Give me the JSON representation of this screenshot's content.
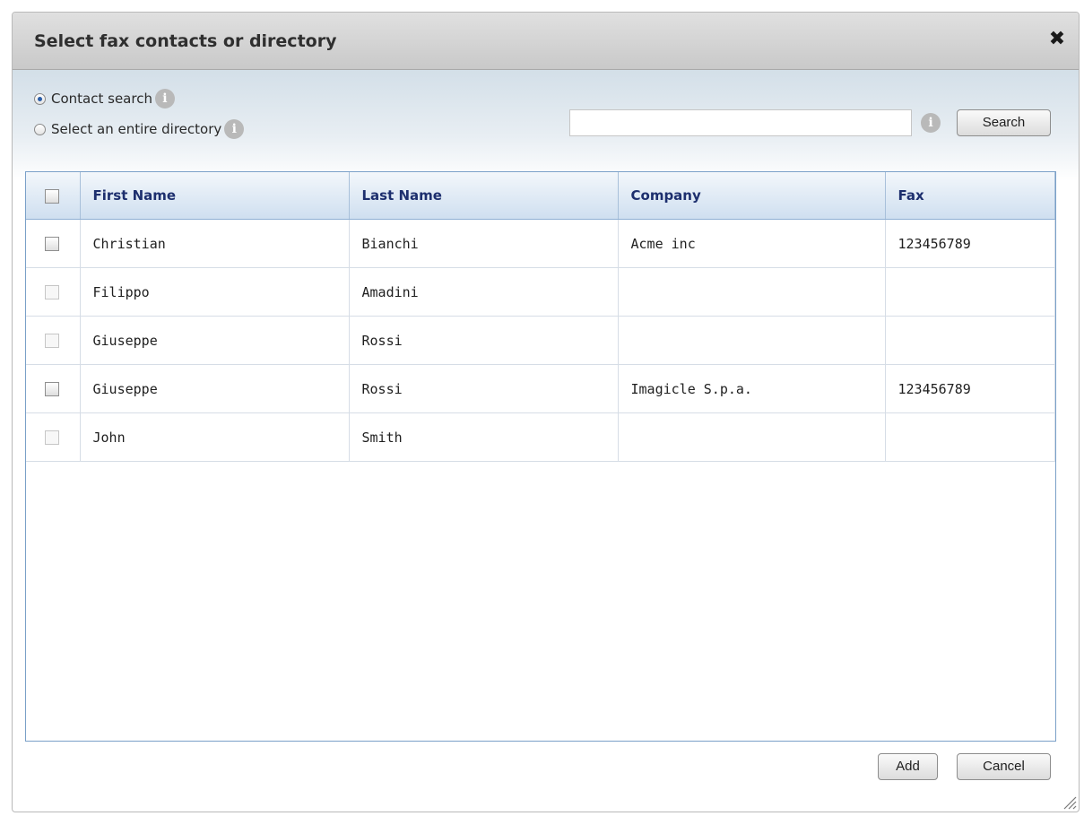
{
  "dialog": {
    "title": "Select fax contacts or directory",
    "close_icon": "close-icon"
  },
  "search": {
    "options": [
      {
        "label": "Contact search",
        "selected": true
      },
      {
        "label": "Select an entire directory",
        "selected": false
      }
    ],
    "input_value": "",
    "info_icon": "info-icon",
    "button_label": "Search"
  },
  "grid": {
    "columns": [
      "First Name",
      "Last Name",
      "Company",
      "Fax"
    ],
    "rows": [
      {
        "first": "Christian",
        "last": "Bianchi",
        "company": "Acme inc",
        "fax": "123456789",
        "selectable": true
      },
      {
        "first": "Filippo",
        "last": "Amadini",
        "company": "",
        "fax": "",
        "selectable": false
      },
      {
        "first": "Giuseppe",
        "last": "Rossi",
        "company": "",
        "fax": "",
        "selectable": false
      },
      {
        "first": "Giuseppe",
        "last": "Rossi",
        "company": "Imagicle S.p.a.",
        "fax": "123456789",
        "selectable": true
      },
      {
        "first": "John",
        "last": "Smith",
        "company": "",
        "fax": "",
        "selectable": false
      }
    ]
  },
  "footer": {
    "add_label": "Add",
    "cancel_label": "Cancel"
  },
  "colors": {
    "header_text": "#1d2f6e",
    "grid_border": "#7aa0c8"
  }
}
